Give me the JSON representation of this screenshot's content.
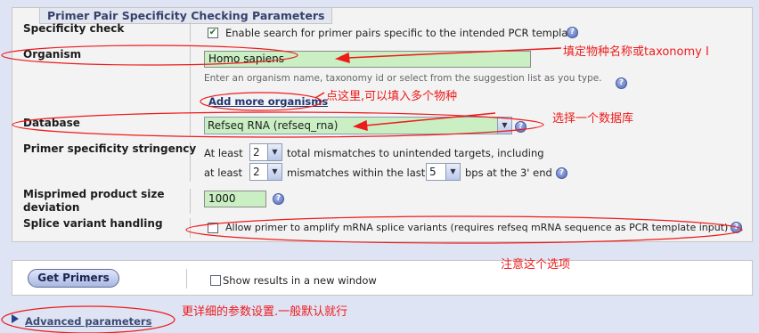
{
  "section_title": "Primer Pair Specificity Checking Parameters",
  "specificity": {
    "label": "Specificity check",
    "checkbox_text": "Enable search for primer pairs specific to the intended PCR template",
    "checked": true
  },
  "organism": {
    "label": "Organism",
    "value": "Homo sapiens",
    "hint": "Enter an organism name, taxonomy id or select from the suggestion list as you type.",
    "add_more": "Add more organisms"
  },
  "database": {
    "label": "Database",
    "selected": "Refseq RNA (refseq_rna)"
  },
  "stringency": {
    "label": "Primer specificity stringency",
    "line1_prefix": "At least",
    "line1_value": "2",
    "line1_suffix": "total mismatches to unintended targets, including",
    "line2_prefix": "at least",
    "line2_value": "2",
    "line2_mid": "mismatches within the last",
    "line2_value2": "5",
    "line2_suffix": "bps at the 3' end"
  },
  "misprimed": {
    "label_line1": "Misprimed product size",
    "label_line2": "deviation",
    "value": "1000"
  },
  "splice": {
    "label": "Splice variant handling",
    "checkbox_text": "Allow primer to amplify mRNA splice variants (requires refseq mRNA sequence as PCR template input)",
    "checked": false
  },
  "actions": {
    "get_primers": "Get Primers",
    "new_window": "Show results in a new window",
    "new_window_checked": false
  },
  "advanced": {
    "label": "Advanced parameters"
  },
  "annotations": {
    "organism_note": "填定物种名称或taxonomy I",
    "add_more_note": "点这里,可以填入多个物种",
    "database_note": "选择一个数据库",
    "splice_note": "注意这个选项",
    "advanced_note": "更详细的参数设置.一般默认就行"
  },
  "colors": {
    "annotation": "#ee1b1b",
    "input_fill": "#c9efc3",
    "panel_bg": "#f3f3f3",
    "page_bg": "#dfe4f4"
  }
}
